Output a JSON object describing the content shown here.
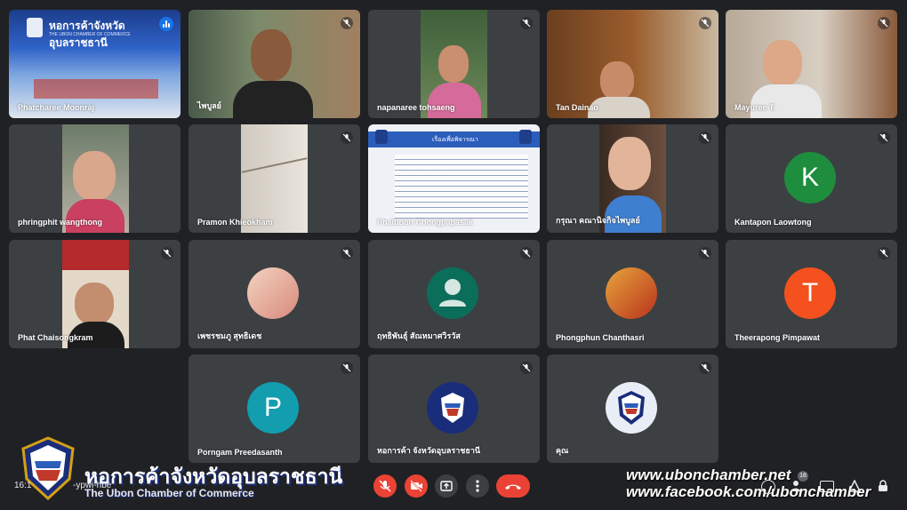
{
  "meeting": {
    "time_code": "16:1",
    "code_fragment": "-ypwi-hbe",
    "participant_count": "18"
  },
  "tiles": [
    {
      "name": "Phatcharee Moonraj"
    },
    {
      "name": "ไพบูลย์"
    },
    {
      "name": "napanaree tohsaeng"
    },
    {
      "name": "Tan Dainao"
    },
    {
      "name": "Mayuree T."
    },
    {
      "name": "phringphit wangthong"
    },
    {
      "name": "Pramon Khieokham"
    },
    {
      "name": "Phaiboon Chongpapasak"
    },
    {
      "name": "กรุณา คณานิจกิจไพบูลย์"
    },
    {
      "name": "Kantapon Laowtong",
      "initial": "K",
      "color": "#1e8e3e"
    },
    {
      "name": "Phat Chaisongkram"
    },
    {
      "name": "เพชรชมภู สุทธิเดช"
    },
    {
      "name": "ฤทธิพันธุ์ สัณหมาศวิรวัส"
    },
    {
      "name": "Phongphun Chanthasri"
    },
    {
      "name": "Theerapong Pimpawat",
      "initial": "T",
      "color": "#f4511e"
    },
    {
      "name": "Porngam Preedasanth",
      "initial": "P",
      "color": "#129eaf"
    },
    {
      "name": "หอการค้า จังหวัดอุบลราชธานี"
    },
    {
      "name": "คุณ"
    }
  ],
  "shared_slide": {
    "title": "เรื่องเพื่อพิจารณา"
  },
  "tile1_banner": {
    "thai": "หอการค้าจังหวัดอุบลราชธานี",
    "english": "THE UBON CHAMBER OF COMMERCE"
  },
  "brand": {
    "thai": "หอการค้าจังหวัดอุบลราชธานี",
    "english": "The Ubon Chamber of Commerce"
  },
  "watermark": {
    "site": "www.ubonchamber.net",
    "facebook": "www.facebook.com/ubonchamber"
  },
  "colors": {
    "leave": "#ea4335",
    "muted": "#ea4335",
    "tile_bg": "#3c4043",
    "page_bg": "#202124",
    "speaking": "#1a73e8"
  },
  "icons": {
    "mic": "mic-off-icon",
    "cam": "camera-off-icon",
    "present": "present-icon",
    "more": "more-icon",
    "leave": "phone-hangup-icon"
  }
}
